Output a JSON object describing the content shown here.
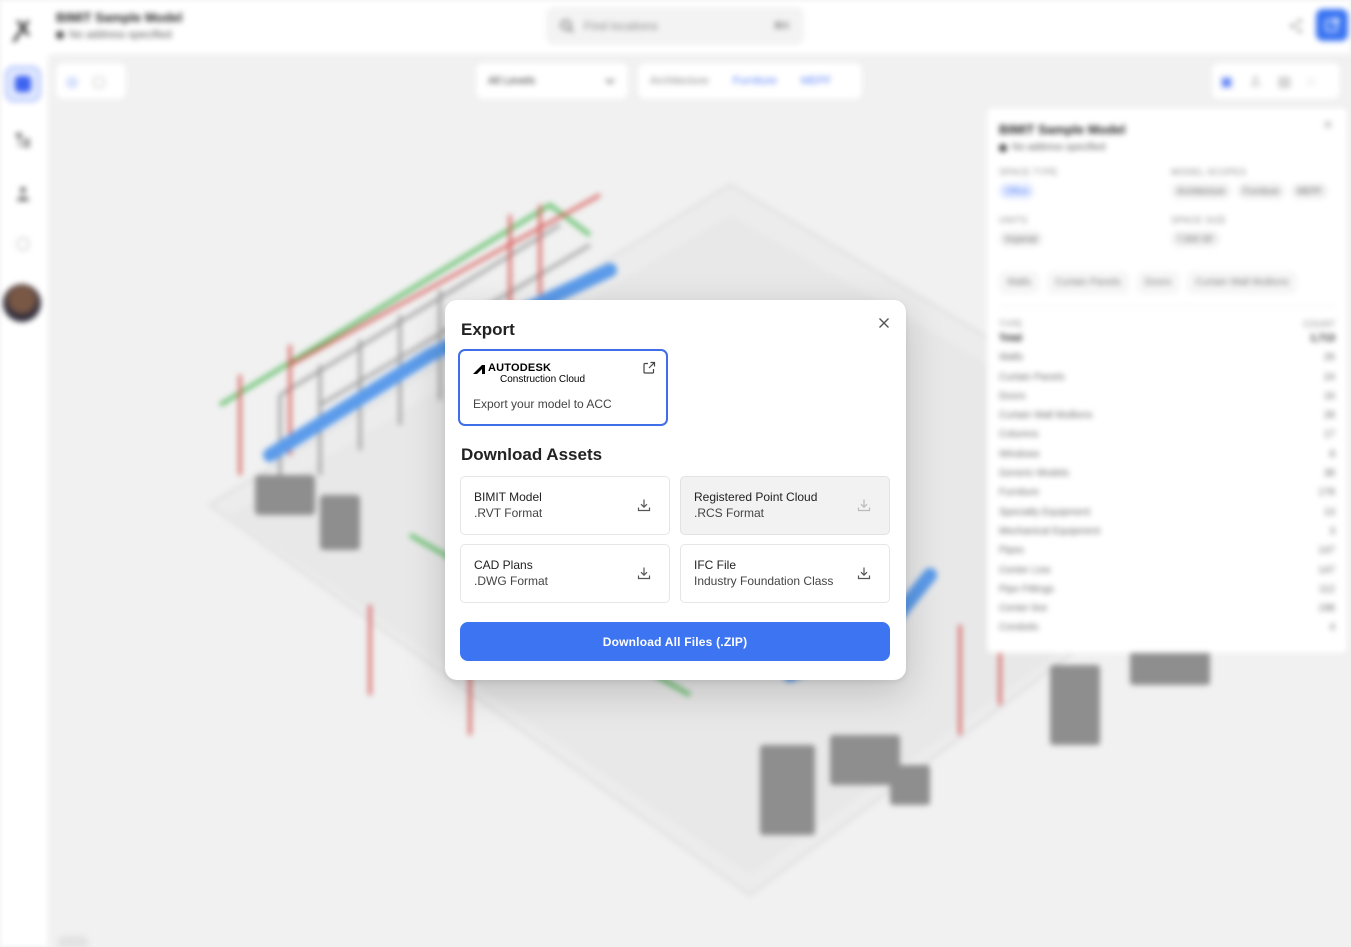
{
  "app": {
    "logo_glyph": "ꭗ",
    "project_title": "BIMIT Sample Model",
    "project_address": "No address specified",
    "search_placeholder": "Find locations",
    "search_shortcut": "⌘K",
    "levels_value": "All Levels",
    "disciplines": [
      "Architecture",
      "Furniture",
      "MEPF"
    ],
    "accent": "#3d74f2"
  },
  "panel": {
    "title": "BIMIT Sample Model",
    "address": "No address specified",
    "space_type_label": "SPACE TYPE",
    "space_type_value": "Office",
    "model_scopes_label": "MODEL SCOPES",
    "model_scopes": [
      "Architecture",
      "Furniture",
      "MEPF"
    ],
    "units_label": "UNITS",
    "units_value": "Imperial",
    "space_size_label": "SPACE SIZE",
    "space_size_value": "7,500 SF",
    "category_tabs": [
      "Walls",
      "Curtain Panels",
      "Doors",
      "Curtain Wall Mullions"
    ],
    "type_header": "TYPE",
    "count_header": "COUNT",
    "rows": [
      {
        "type": "Total",
        "count": "1,713"
      },
      {
        "type": "Walls",
        "count": "26"
      },
      {
        "type": "Curtain Panels",
        "count": "24"
      },
      {
        "type": "Doors",
        "count": "16"
      },
      {
        "type": "Curtain Wall Mullions",
        "count": "28"
      },
      {
        "type": "Columns",
        "count": "17"
      },
      {
        "type": "Windows",
        "count": "8"
      },
      {
        "type": "Generic Models",
        "count": "38"
      },
      {
        "type": "Furniture",
        "count": "178"
      },
      {
        "type": "Specialty Equipment",
        "count": "13"
      },
      {
        "type": "Mechanical Equipment",
        "count": "3"
      },
      {
        "type": "Pipes",
        "count": "147"
      },
      {
        "type": "Center Line",
        "count": "147"
      },
      {
        "type": "Pipe Fittings",
        "count": "112"
      },
      {
        "type": "Center line",
        "count": "198"
      },
      {
        "type": "Conduits",
        "count": "4"
      }
    ]
  },
  "modal": {
    "export_heading": "Export",
    "acc": {
      "brand": "AUTODESK",
      "product": "Construction Cloud",
      "description": "Export your model to ACC"
    },
    "download_heading": "Download Assets",
    "assets": [
      {
        "title": "BIMIT Model",
        "format": ".RVT Format"
      },
      {
        "title": "Registered Point Cloud",
        "format": ".RCS Format"
      },
      {
        "title": "CAD Plans",
        "format": ".DWG Format"
      },
      {
        "title": "IFC File",
        "format": "Industry Foundation Class"
      }
    ],
    "download_all_label": "Download All Files (.ZIP)"
  }
}
